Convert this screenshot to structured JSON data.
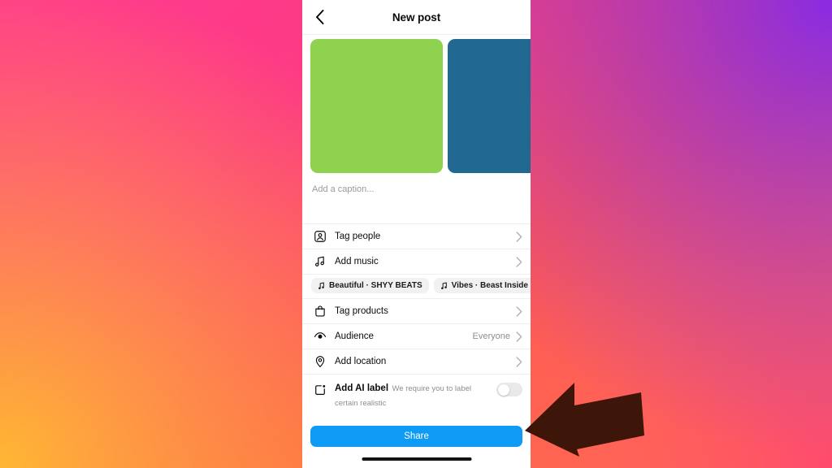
{
  "background": {
    "description": "instagram-style pink-orange-purple gradient",
    "colors": [
      "#ff2f92",
      "#ff5a4d",
      "#ff9b2e",
      "#8a2be2",
      "#ff4a6e"
    ]
  },
  "phone": {
    "header": {
      "back_icon": "chevron-left-icon",
      "title": "New post"
    },
    "media": {
      "thumbnails": [
        {
          "name": "photo-thumbnail-1",
          "color": "#8ed24f"
        },
        {
          "name": "photo-thumbnail-2",
          "color": "#20688f"
        }
      ]
    },
    "caption": {
      "placeholder": "Add a caption...",
      "value": ""
    },
    "rows": [
      {
        "icon": "tag-people-icon",
        "label": "Tag people",
        "value": "",
        "chevron": "›"
      },
      {
        "icon": "music-note-icon",
        "label": "Add music",
        "value": "",
        "chevron": "›"
      },
      {
        "icon": "shopping-bag-icon",
        "label": "Tag products",
        "value": "",
        "chevron": "›"
      },
      {
        "icon": "eye-icon",
        "label": "Audience",
        "value": "Everyone",
        "chevron": "›"
      },
      {
        "icon": "location-pin-icon",
        "label": "Add location",
        "value": "",
        "chevron": "›"
      }
    ],
    "music_chips": [
      {
        "icon": "music-note-icon",
        "label": "Beautiful · SHYY BEATS"
      },
      {
        "icon": "music-note-icon",
        "label": "Vibes · Beast Inside Beats"
      }
    ],
    "ai_label": {
      "icon": "ai-label-icon",
      "title": "Add AI label",
      "description": "We require you to label certain realistic",
      "toggle_state": "off"
    },
    "share": {
      "label": "Share",
      "color": "#0d9bf5"
    },
    "home_indicator": true
  },
  "annotation": {
    "arrow": {
      "name": "pointer-arrow",
      "direction": "left",
      "color": "#3d1509",
      "points_at": "Share"
    }
  }
}
